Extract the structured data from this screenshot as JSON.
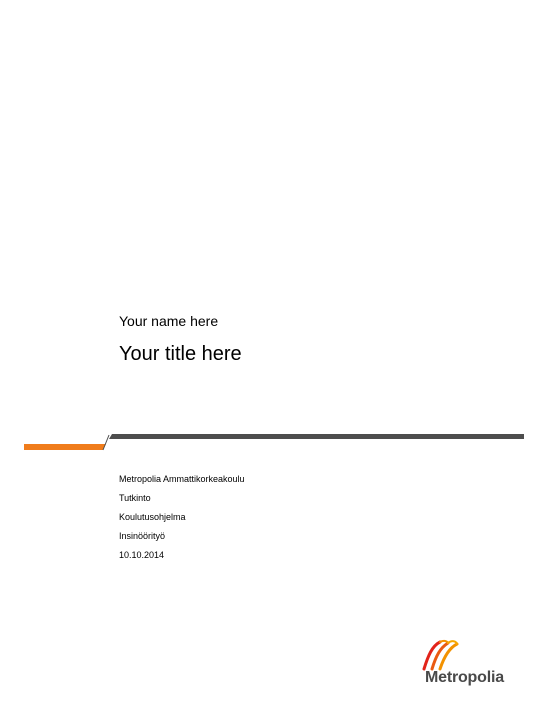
{
  "document": {
    "author": "Your name here",
    "title": "Your title here"
  },
  "meta": {
    "institution": "Metropolia Ammattikorkeakoulu",
    "degree": "Tutkinto",
    "programme": "Koulutusohjelma",
    "thesis_type": "Insinöörityö",
    "date": "10.10.2014"
  },
  "logo": {
    "text": "Metropolia"
  },
  "colors": {
    "accent_orange": "#f07c1b",
    "divider_dark": "#4d4d4d",
    "logo_text": "#4a4a4a",
    "logo_red": "#e2231a",
    "logo_orange": "#f39200"
  }
}
